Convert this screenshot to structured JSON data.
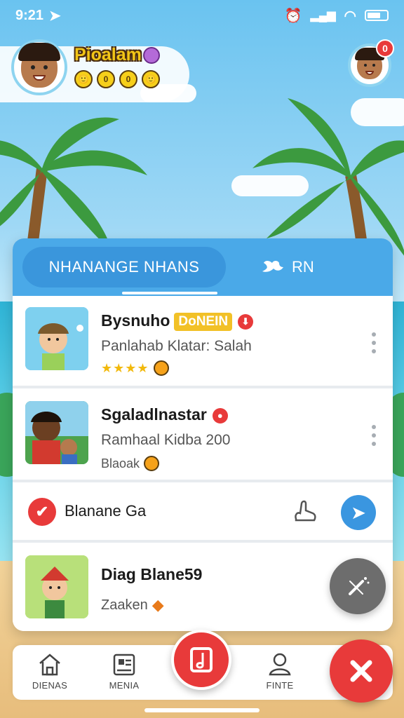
{
  "status_bar": {
    "time": "9:21"
  },
  "profile": {
    "username": "Pioalam",
    "emoji_row": [
      "🙂",
      "0",
      "0",
      "🙂"
    ]
  },
  "notifications": {
    "count": "0"
  },
  "tabs": {
    "active_label": "NHANANGE NHANS",
    "secondary_label": "RN"
  },
  "list": [
    {
      "title": "Bysnuho",
      "badge": "DoNEIN",
      "subtitle": "Panlahab Klatar: Salah",
      "rating_stars": "★★★★"
    },
    {
      "title": "Sgaladlnastar",
      "subtitle": "Ramhaal Kidba 200",
      "meta": "Blaoak"
    },
    {
      "title": "Diag Blane59",
      "subtitle": "Zaaken"
    }
  ],
  "action_row": {
    "label": "Blanane Ga"
  },
  "bottom_nav": {
    "items": [
      {
        "label": "DIENAS"
      },
      {
        "label": "MENIA"
      },
      {
        "label": "FINTE"
      }
    ]
  },
  "colors": {
    "accent_blue": "#4aa9e8",
    "accent_red": "#e83a3a",
    "star_gold": "#f2b90c"
  }
}
